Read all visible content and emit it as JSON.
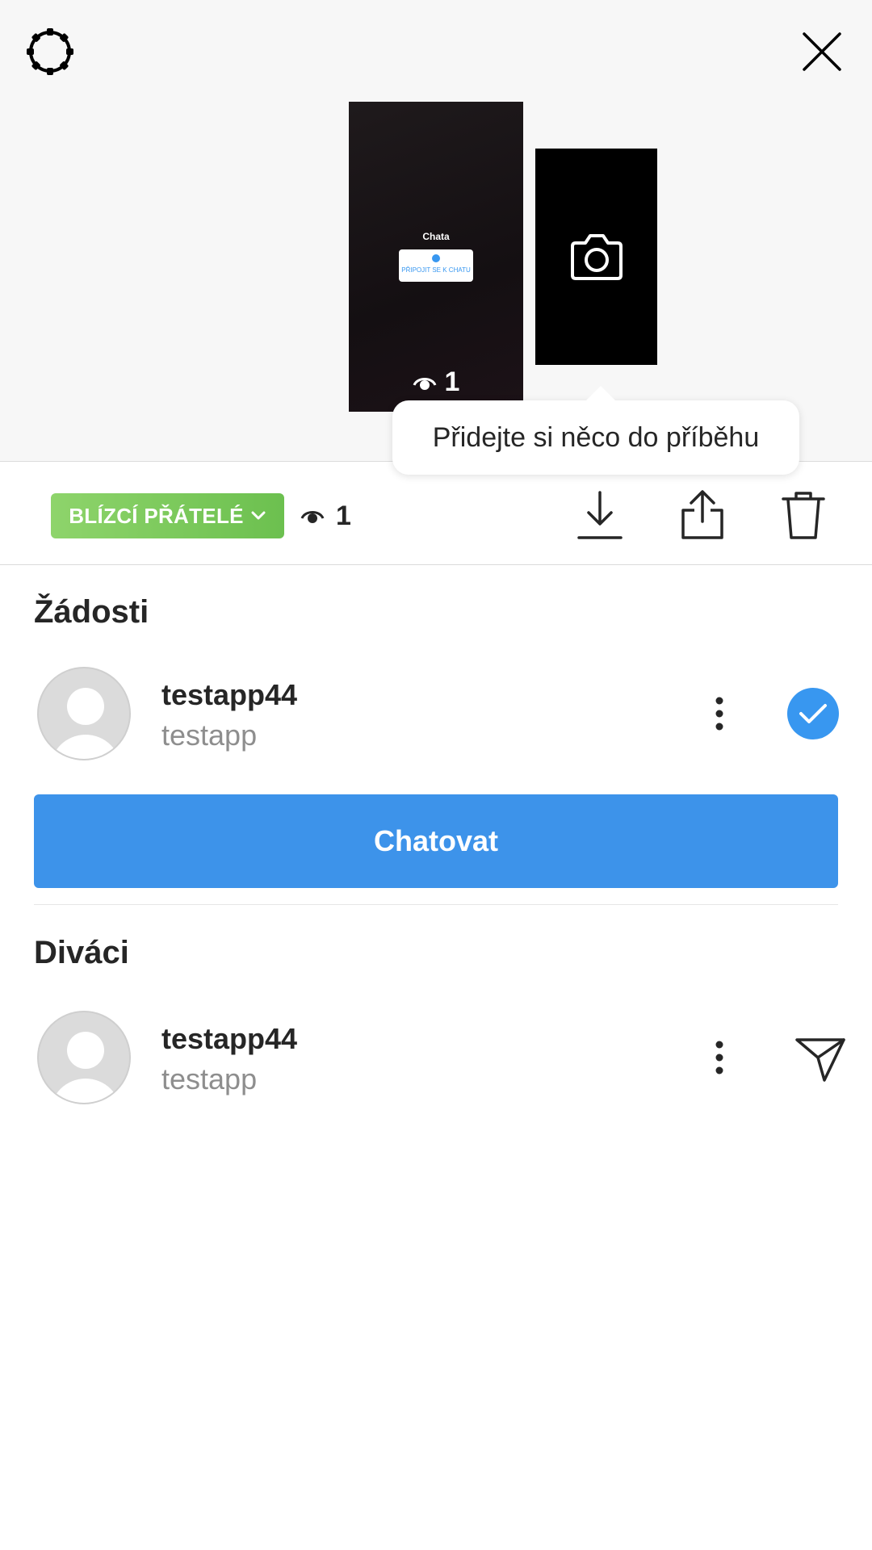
{
  "story": {
    "thumb_title": "Chata",
    "thumb_sticker_text": "PŘIPOJIT SE K CHATU",
    "thumb_view_count": "1"
  },
  "tooltip": {
    "text": "Přidejte si něco do příběhu"
  },
  "toolbar": {
    "audience_label": "BLÍZCÍ PŘÁTELÉ",
    "view_count": "1"
  },
  "requests": {
    "title": "Žádosti",
    "items": [
      {
        "username": "testapp44",
        "fullname": "testapp"
      }
    ],
    "chat_button_label": "Chatovat"
  },
  "viewers": {
    "title": "Diváci",
    "items": [
      {
        "username": "testapp44",
        "fullname": "testapp"
      }
    ]
  },
  "colors": {
    "accent_blue": "#3897f0",
    "close_friends_green": "#7ccb5d",
    "text_primary": "#262626",
    "text_secondary": "#8e8e8e"
  },
  "icons": {
    "settings": "gear-icon",
    "close": "close-icon",
    "camera": "camera-icon",
    "eye": "eye-icon",
    "download": "download-icon",
    "share": "share-icon",
    "delete": "trash-icon",
    "more": "more-vertical-icon",
    "approve": "check-icon",
    "send": "paper-plane-icon"
  }
}
